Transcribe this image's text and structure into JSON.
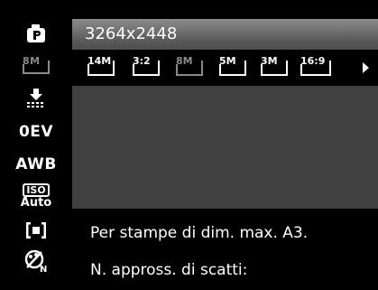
{
  "sidebar": {
    "items": [
      {
        "name": "program-mode",
        "icon": "camera-p-icon"
      },
      {
        "name": "resolution",
        "label": "8M",
        "icon": "resolution-8m-icon"
      },
      {
        "name": "quality",
        "icon": "quality-stars-icon"
      },
      {
        "name": "exposure",
        "label": "0EV"
      },
      {
        "name": "white-balance",
        "label": "AWB"
      },
      {
        "name": "iso",
        "label_top": "ISO",
        "label_bottom": "Auto"
      },
      {
        "name": "metering",
        "icon": "metering-icon"
      },
      {
        "name": "color",
        "icon": "color-mode-icon"
      }
    ]
  },
  "main": {
    "selected_resolution": "3264x2448",
    "options": [
      {
        "label": "14M",
        "state": "normal"
      },
      {
        "label": "3:2",
        "state": "normal"
      },
      {
        "label": "8M",
        "state": "selected"
      },
      {
        "label": "5M",
        "state": "normal"
      },
      {
        "label": "3M",
        "state": "normal"
      },
      {
        "label": "16:9",
        "state": "normal"
      }
    ],
    "info_line1": "Per stampe di dim. max. A3.",
    "info_line2": "N. appross. di scatti:"
  },
  "colors": {
    "background": "#000000",
    "panel": "#404040",
    "highlight_bar": "#7a7a7a",
    "text": "#ffffff",
    "dim": "#8a8a8a"
  }
}
